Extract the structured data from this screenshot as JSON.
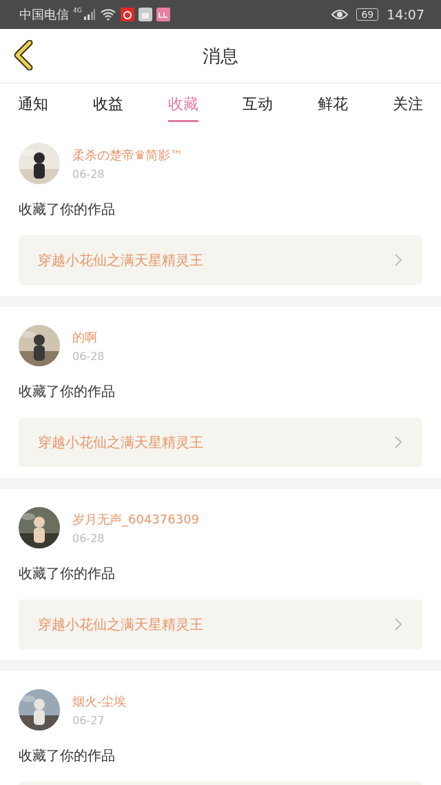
{
  "status_bar": {
    "carrier": "中国电信",
    "network": "4G",
    "battery": "69",
    "time": "14:07"
  },
  "header": {
    "title": "消息"
  },
  "tabs": [
    {
      "label": "通知",
      "selected": false
    },
    {
      "label": "收益",
      "selected": false
    },
    {
      "label": "收藏",
      "selected": true
    },
    {
      "label": "互动",
      "selected": false
    },
    {
      "label": "鲜花",
      "selected": false
    },
    {
      "label": "关注",
      "selected": false
    }
  ],
  "messages": [
    {
      "name": "柔杀の楚帝♛简影™",
      "date": "06-28",
      "text": "收藏了你的作品",
      "work": "穿越小花仙之满天星精灵王"
    },
    {
      "name": "的啊",
      "date": "06-28",
      "text": "收藏了你的作品",
      "work": "穿越小花仙之满天星精灵王"
    },
    {
      "name": "岁月无声_604376309",
      "date": "06-28",
      "text": "收藏了你的作品",
      "work": "穿越小花仙之满天星精灵王"
    },
    {
      "name": "烟火-尘埃",
      "date": "06-27",
      "text": "收藏了你的作品"
    }
  ]
}
